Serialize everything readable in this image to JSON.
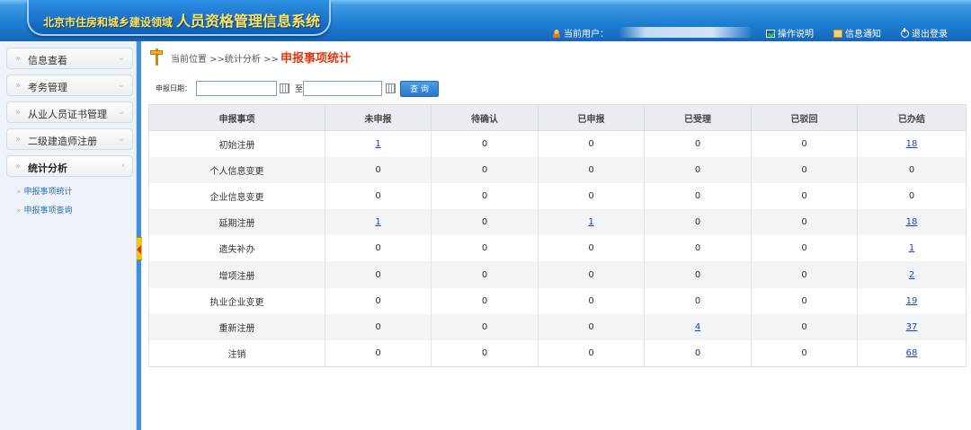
{
  "header": {
    "title_small": "北京市住房和城乡建设领域",
    "title_big": "人员资格管理信息系统",
    "current_user_label": "当前用户：",
    "links": [
      {
        "label": "操作说明",
        "icon": "help-icon"
      },
      {
        "label": "信息通知",
        "icon": "mail-icon"
      },
      {
        "label": "退出登录",
        "icon": "power-icon"
      }
    ]
  },
  "sidebar": {
    "items": [
      {
        "label": "信息查看",
        "chevron": "⌄"
      },
      {
        "label": "考务管理",
        "chevron": "⌄"
      },
      {
        "label": "从业人员证书管理",
        "chevron": "⌄"
      },
      {
        "label": "二级建造师注册",
        "chevron": "⌄"
      },
      {
        "label": "统计分析",
        "chevron": "‹"
      }
    ],
    "sub_items": [
      {
        "label": "申报事项统计"
      },
      {
        "label": "申报事项查询"
      }
    ],
    "arrow_glyph": "»"
  },
  "breadcrumb": {
    "path": "当前位置 >>统计分析 >>",
    "current": "申报事项统计"
  },
  "search": {
    "date_label": "申报日期：",
    "start_value": "",
    "end_value": "",
    "to_label": "至",
    "query_button": "查 询"
  },
  "table": {
    "headers": [
      "申报事项",
      "未申报",
      "待确认",
      "已申报",
      "已受理",
      "已驳回",
      "已办结"
    ],
    "rows": [
      {
        "cells": [
          "初始注册",
          "1",
          "0",
          "0",
          "0",
          "0",
          "18"
        ],
        "links": [
          false,
          true,
          false,
          false,
          false,
          false,
          true
        ]
      },
      {
        "cells": [
          "个人信息变更",
          "0",
          "0",
          "0",
          "0",
          "0",
          "0"
        ],
        "links": [
          false,
          false,
          false,
          false,
          false,
          false,
          false
        ]
      },
      {
        "cells": [
          "企业信息变更",
          "0",
          "0",
          "0",
          "0",
          "0",
          "0"
        ],
        "links": [
          false,
          false,
          false,
          false,
          false,
          false,
          false
        ]
      },
      {
        "cells": [
          "延期注册",
          "1",
          "0",
          "1",
          "0",
          "0",
          "18"
        ],
        "links": [
          false,
          true,
          false,
          true,
          false,
          false,
          true
        ]
      },
      {
        "cells": [
          "遗失补办",
          "0",
          "0",
          "0",
          "0",
          "0",
          "1"
        ],
        "links": [
          false,
          false,
          false,
          false,
          false,
          false,
          true
        ]
      },
      {
        "cells": [
          "增项注册",
          "0",
          "0",
          "0",
          "0",
          "0",
          "2"
        ],
        "links": [
          false,
          false,
          false,
          false,
          false,
          false,
          true
        ]
      },
      {
        "cells": [
          "执业企业变更",
          "0",
          "0",
          "0",
          "0",
          "0",
          "19"
        ],
        "links": [
          false,
          false,
          false,
          false,
          false,
          false,
          true
        ]
      },
      {
        "cells": [
          "重新注册",
          "0",
          "0",
          "0",
          "4",
          "0",
          "37"
        ],
        "links": [
          false,
          false,
          false,
          false,
          true,
          false,
          true
        ]
      },
      {
        "cells": [
          "注销",
          "0",
          "0",
          "0",
          "0",
          "0",
          "68"
        ],
        "links": [
          false,
          false,
          false,
          false,
          false,
          false,
          true
        ]
      }
    ]
  },
  "colors": {
    "header_blue": "#1f7fd3",
    "title_yellow": "#ffe45c",
    "accent_red": "#e03a12",
    "link_blue": "#1a3fc7",
    "button_blue": "#2a79cb"
  }
}
